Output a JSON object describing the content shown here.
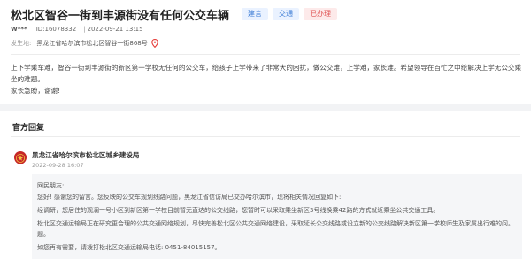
{
  "question": {
    "title": "松北区智谷一街到丰源街没有任何公交车辆",
    "tags": [
      "建言",
      "交通",
      "已办理"
    ],
    "user": "W***",
    "id_label": "ID:16078332",
    "date": "2022-09-21 13:15",
    "location_label": "发生地:",
    "location_value": "黑龙江省哈尔滨市松北区智谷一街868号",
    "content_line1": "上下学乘车难，智谷一街到丰源街的新区第一学校无任何的公交车，给孩子上学带来了非常大的困扰，做公交难，上学难，家长难。希望领导在百忙之中给解决上学无公交乘坐的难题。",
    "content_line2": "家长急盼，谢谢!"
  },
  "reply": {
    "heading": "官方回复",
    "org": "黑龙江省哈尔滨市松北区城乡建设局",
    "time": "2022-09-28 16:07",
    "lines": [
      "网民朋友:",
      "您好! 感谢您的留言。您反映的公交车规划线路问题，黑龙江省信访局已交办哈尔滨市，现将相关情况回复如下:",
      "经调研，您居住的观澜一号小区到新区第一学校目前暂无直达的公交线路，您暂时可以采取乘坐新区3号线换乘42路的方式就近乘坐公共交通工具。",
      "松北区交通运输局正在研究更合理的公共交通网络规划，尽快完善松北区公共交通网络建设，采取延长公交线路或设立新的公交线路解决新区第一学校师生及家属出行难的问。",
      "题。",
      "如您再有需要，请拨打松北区交通运输局电话:  0451-84015157。"
    ]
  },
  "colors": {
    "tag_blue_bg": "#eaf2ff",
    "tag_blue_text": "#3a7bd5",
    "tag_red_bg": "#fdeaea",
    "tag_red_text": "#e05555",
    "pin": "#e53935",
    "org_logo": "#c62828"
  },
  "icons": {
    "location": "location-pin-icon",
    "org_logo": "government-emblem-icon"
  }
}
